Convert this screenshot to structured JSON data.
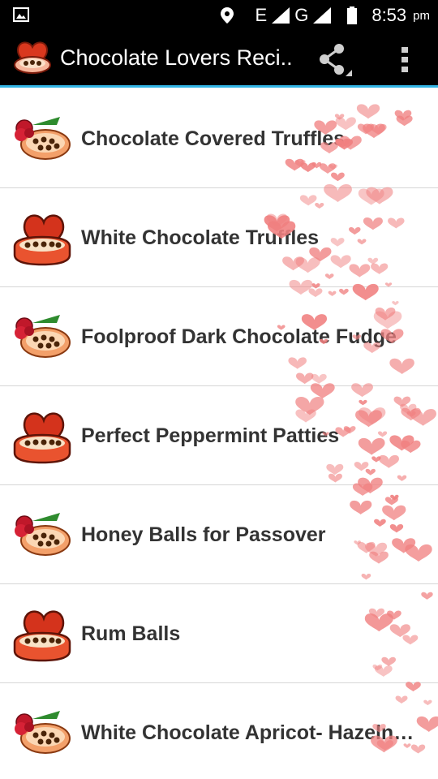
{
  "status_bar": {
    "network_e": "E",
    "network_g": "G",
    "time": "8:53",
    "ampm": "pm",
    "icons": [
      "image-notification-icon",
      "location-icon",
      "signal-icon",
      "battery-icon"
    ]
  },
  "app_bar": {
    "title": "Chocolate Lovers Reci..",
    "icons": [
      "app-logo-icon",
      "share-icon",
      "overflow-menu-icon"
    ],
    "accent_color": "#33b5e5"
  },
  "recipes": [
    {
      "title": "Chocolate Covered Truffles",
      "icon": "rose-chocolate-box-icon"
    },
    {
      "title": "White Chocolate Truffles",
      "icon": "heart-chocolate-box-icon"
    },
    {
      "title": "Foolproof Dark Chocolate Fudge",
      "icon": "rose-chocolate-box-icon"
    },
    {
      "title": "Perfect Peppermint Patties",
      "icon": "heart-chocolate-box-icon"
    },
    {
      "title": "Honey Balls for Passover",
      "icon": "rose-chocolate-box-icon"
    },
    {
      "title": "Rum Balls",
      "icon": "heart-chocolate-box-icon"
    },
    {
      "title": "White Chocolate Apricot- Hazeln…",
      "icon": "rose-chocolate-box-icon"
    }
  ],
  "colors": {
    "background": "#ffffff",
    "text": "#333333",
    "divider": "#d6d6d6",
    "heart": "#f08080"
  }
}
